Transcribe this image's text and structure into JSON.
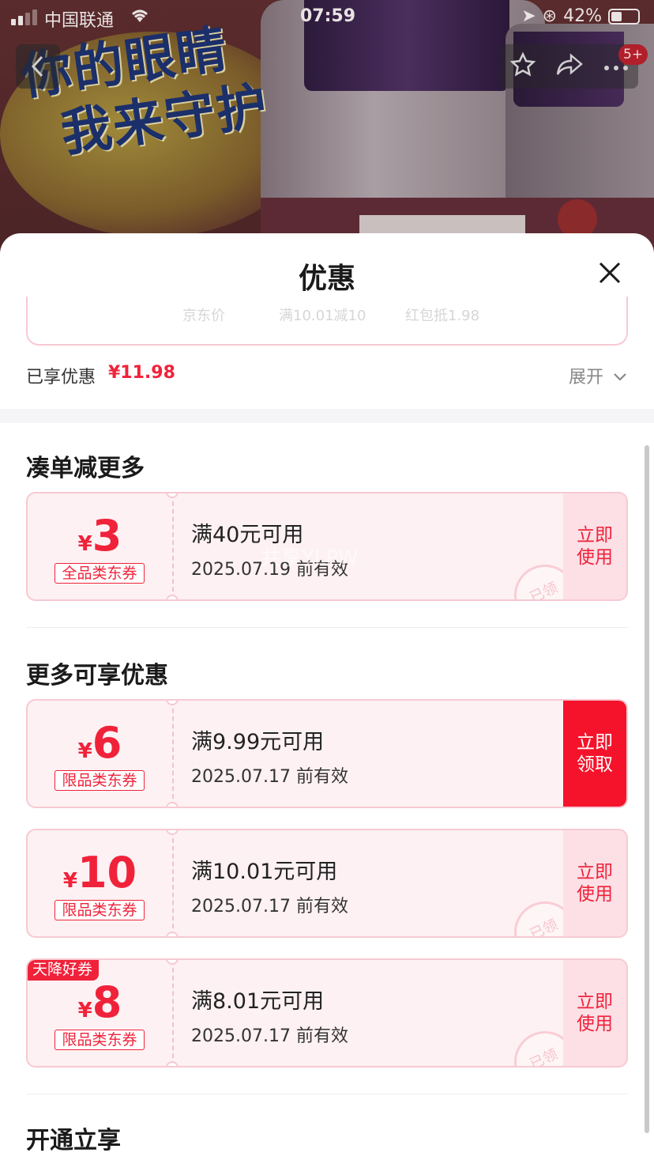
{
  "status_bar": {
    "carrier": "中国联通",
    "time": "07:59",
    "battery": "42%"
  },
  "banner": {
    "slogan_line1": "你的眼睛",
    "slogan_line2": "我来守护",
    "nav_badge": "5+"
  },
  "sheet": {
    "title": "优惠",
    "price_row": {
      "item1": "京东价",
      "item2": "满10.01减10",
      "item3": "红包抵1.98"
    },
    "enjoyed_label": "已享优惠",
    "enjoyed_amount": "¥11.98",
    "expand_label": "展开"
  },
  "sections": {
    "section1_title": "凑单减更多",
    "section2_title": "更多可享优惠",
    "section3_title": "开通立享"
  },
  "coupons": [
    {
      "yen": "¥",
      "amount": "3",
      "type": "全品类东券",
      "condition": "满40元可用",
      "validity": "2025.07.19 前有效",
      "action": "立即\n使用",
      "stamp": "已领"
    },
    {
      "yen": "¥",
      "amount": "6",
      "type": "限品类东券",
      "condition": "满9.99元可用",
      "validity": "2025.07.17 前有效",
      "action": "立即\n领取"
    },
    {
      "yen": "¥",
      "amount": "10",
      "type": "限品类东券",
      "condition": "满10.01元可用",
      "validity": "2025.07.17 前有效",
      "action": "立即\n使用",
      "stamp": "已领"
    },
    {
      "yen": "¥",
      "amount": "8",
      "type": "限品类东券",
      "condition": "满8.01元可用",
      "validity": "2025.07.17 前有效",
      "action": "立即\n使用",
      "stamp": "已领",
      "ribbon": "天降好券"
    }
  ],
  "watermark": "共享YLPW",
  "colors": {
    "accent_red": "#f0223a",
    "primary_button": "#f5132b",
    "coupon_bg": "#fdf1f3",
    "coupon_border": "#f7c9d3"
  },
  "icons": {
    "back": "chevron-left-icon",
    "favorite": "star-icon",
    "share": "share-arrow-icon",
    "more": "more-dots-icon",
    "close": "close-icon",
    "expand": "chevron-down-icon"
  }
}
